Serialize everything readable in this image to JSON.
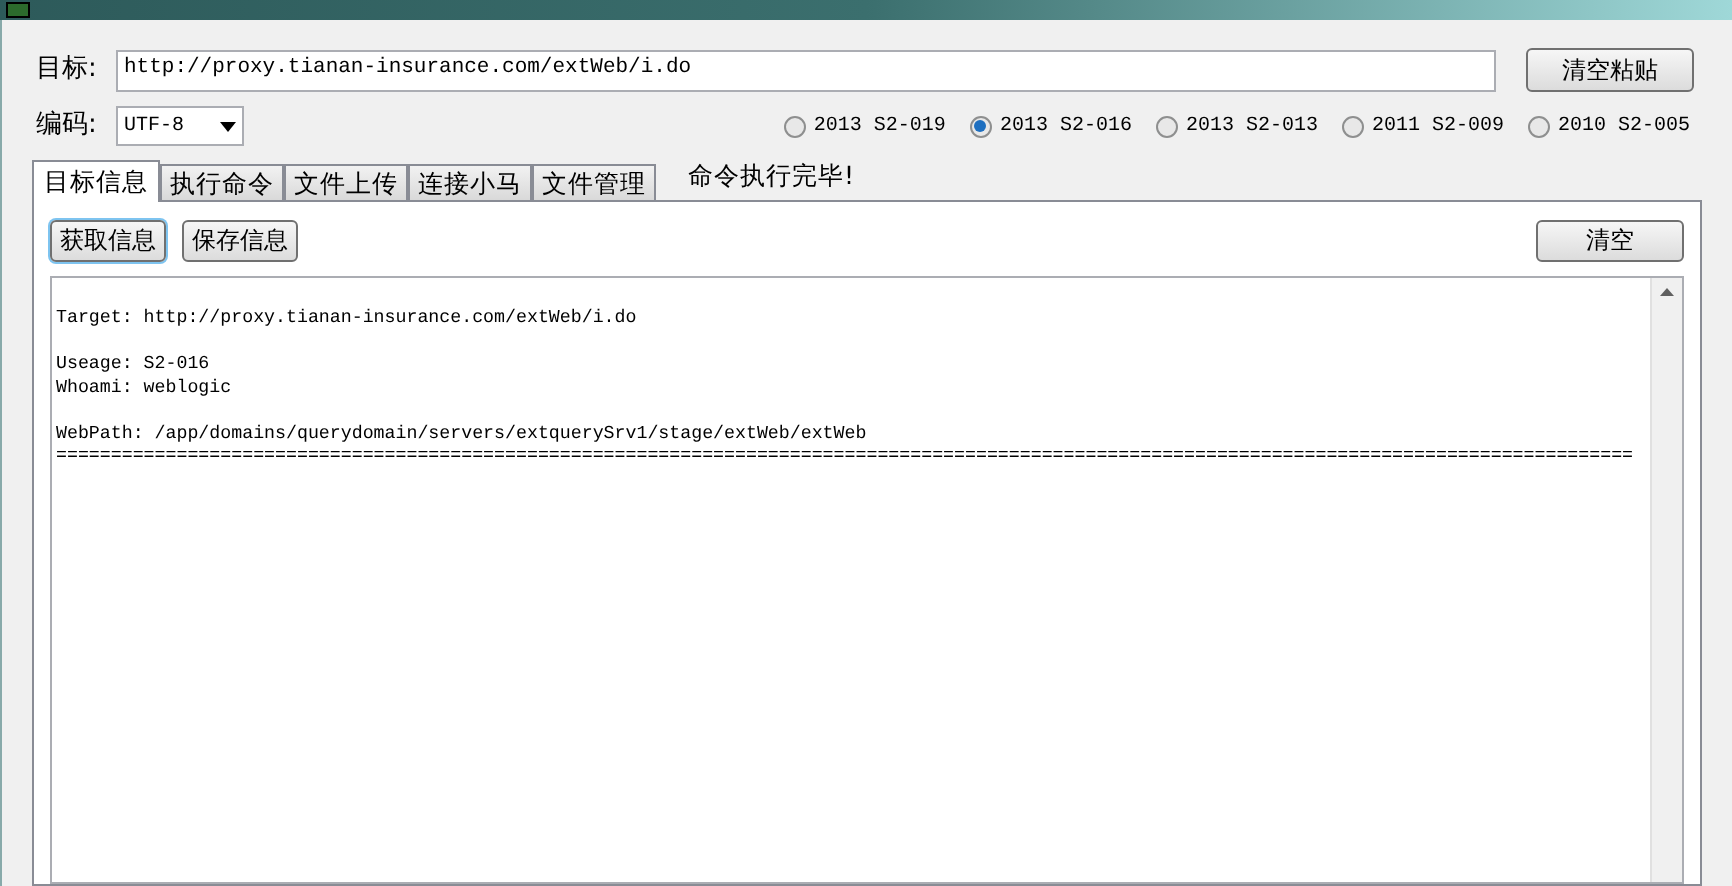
{
  "target": {
    "label": "目标:",
    "value": "http://proxy.tianan-insurance.com/extWeb/i.do"
  },
  "paste_button": "清空粘贴",
  "encoding": {
    "label": "编码:",
    "value": "UTF-8"
  },
  "exploits": [
    {
      "label": "2013 S2-019",
      "selected": false
    },
    {
      "label": "2013 S2-016",
      "selected": true
    },
    {
      "label": "2013 S2-013",
      "selected": false
    },
    {
      "label": "2011 S2-009",
      "selected": false
    },
    {
      "label": "2010 S2-005",
      "selected": false
    }
  ],
  "tabs": [
    {
      "label": "目标信息",
      "selected": true
    },
    {
      "label": "执行命令",
      "selected": false
    },
    {
      "label": "文件上传",
      "selected": false
    },
    {
      "label": "连接小马",
      "selected": false
    },
    {
      "label": "文件管理",
      "selected": false
    }
  ],
  "status": "命令执行完毕!",
  "panel_buttons": [
    {
      "label": "获取信息",
      "focused": true
    },
    {
      "label": "保存信息",
      "focused": false
    }
  ],
  "clear_button": "清空",
  "output": [
    [
      "Target: http://proxy.tianan-insurance.com/extWeb/i.do"
    ],
    [
      "Useage: S2-016",
      "Whoami: weblogic"
    ],
    [
      "WebPath: /app/domains/querydomain/servers/extquerySrv1/stage/extWeb/extWeb",
      "================================================================================================================================================"
    ]
  ]
}
